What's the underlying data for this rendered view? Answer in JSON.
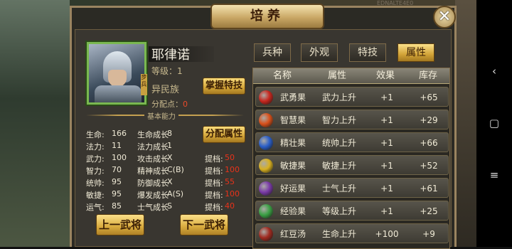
{
  "dialog": {
    "title": "培养",
    "close_glyph": "✕"
  },
  "hero": {
    "name": "耶律诺",
    "level": "等级：1",
    "race": "异民族",
    "alloc_label": "分配点：",
    "alloc_value": "0",
    "portrait_tag": "步兵"
  },
  "buttons": {
    "master_skill": "掌握特技",
    "alloc_attr": "分配属性",
    "prev_general": "上一武将",
    "next_general": "下一武将"
  },
  "section_label": "基本能力",
  "stats": [
    {
      "k": "生命:",
      "v": "166",
      "gk": "生命成长",
      "gv": "8",
      "tk": "",
      "tv": ""
    },
    {
      "k": "法力:",
      "v": "11",
      "gk": "法力成长",
      "gv": "1",
      "tk": "",
      "tv": ""
    },
    {
      "k": "武力:",
      "v": "100",
      "gk": "攻击成长",
      "gv": "X",
      "tk": "提档:",
      "tv": "50"
    },
    {
      "k": "智力:",
      "v": "70",
      "gk": "精神成长",
      "gv": "C(B)",
      "tk": "提档:",
      "tv": "100"
    },
    {
      "k": "统帅:",
      "v": "95",
      "gk": "防御成长",
      "gv": "X",
      "tk": "提档:",
      "tv": "55"
    },
    {
      "k": "敏捷:",
      "v": "95",
      "gk": "爆发成长",
      "gv": "A(S)",
      "tk": "提档:",
      "tv": "100"
    },
    {
      "k": "运气:",
      "v": "85",
      "gk": "士气成长",
      "gv": "S",
      "tk": "提档:",
      "tv": "40"
    }
  ],
  "tabs": [
    "兵种",
    "外观",
    "特技",
    "属性"
  ],
  "table": {
    "headers": [
      "名称",
      "属性",
      "效果",
      "库存"
    ],
    "rows": [
      {
        "name": "武勇果",
        "attr": "武力上升",
        "effect": "+1",
        "stock": "+65",
        "color": "#c8261e"
      },
      {
        "name": "智慧果",
        "attr": "智力上升",
        "effect": "+1",
        "stock": "+29",
        "color": "#d8501a"
      },
      {
        "name": "精壮果",
        "attr": "统帅上升",
        "effect": "+1",
        "stock": "+66",
        "color": "#2a5ec8"
      },
      {
        "name": "敏捷果",
        "attr": "敏捷上升",
        "effect": "+1",
        "stock": "+52",
        "color": "#d8b020"
      },
      {
        "name": "好运果",
        "attr": "士气上升",
        "effect": "+1",
        "stock": "+61",
        "color": "#7a3aa8"
      },
      {
        "name": "经验果",
        "attr": "等级上升",
        "effect": "+1",
        "stock": "+25",
        "color": "#3aa044"
      },
      {
        "name": "红豆汤",
        "attr": "生命上升",
        "effect": "+100",
        "stock": "+9",
        "color": "#a02a20"
      }
    ]
  },
  "system_nav": [
    "‹",
    "▢",
    "≡"
  ],
  "status_text": "EDNALTE4E0"
}
